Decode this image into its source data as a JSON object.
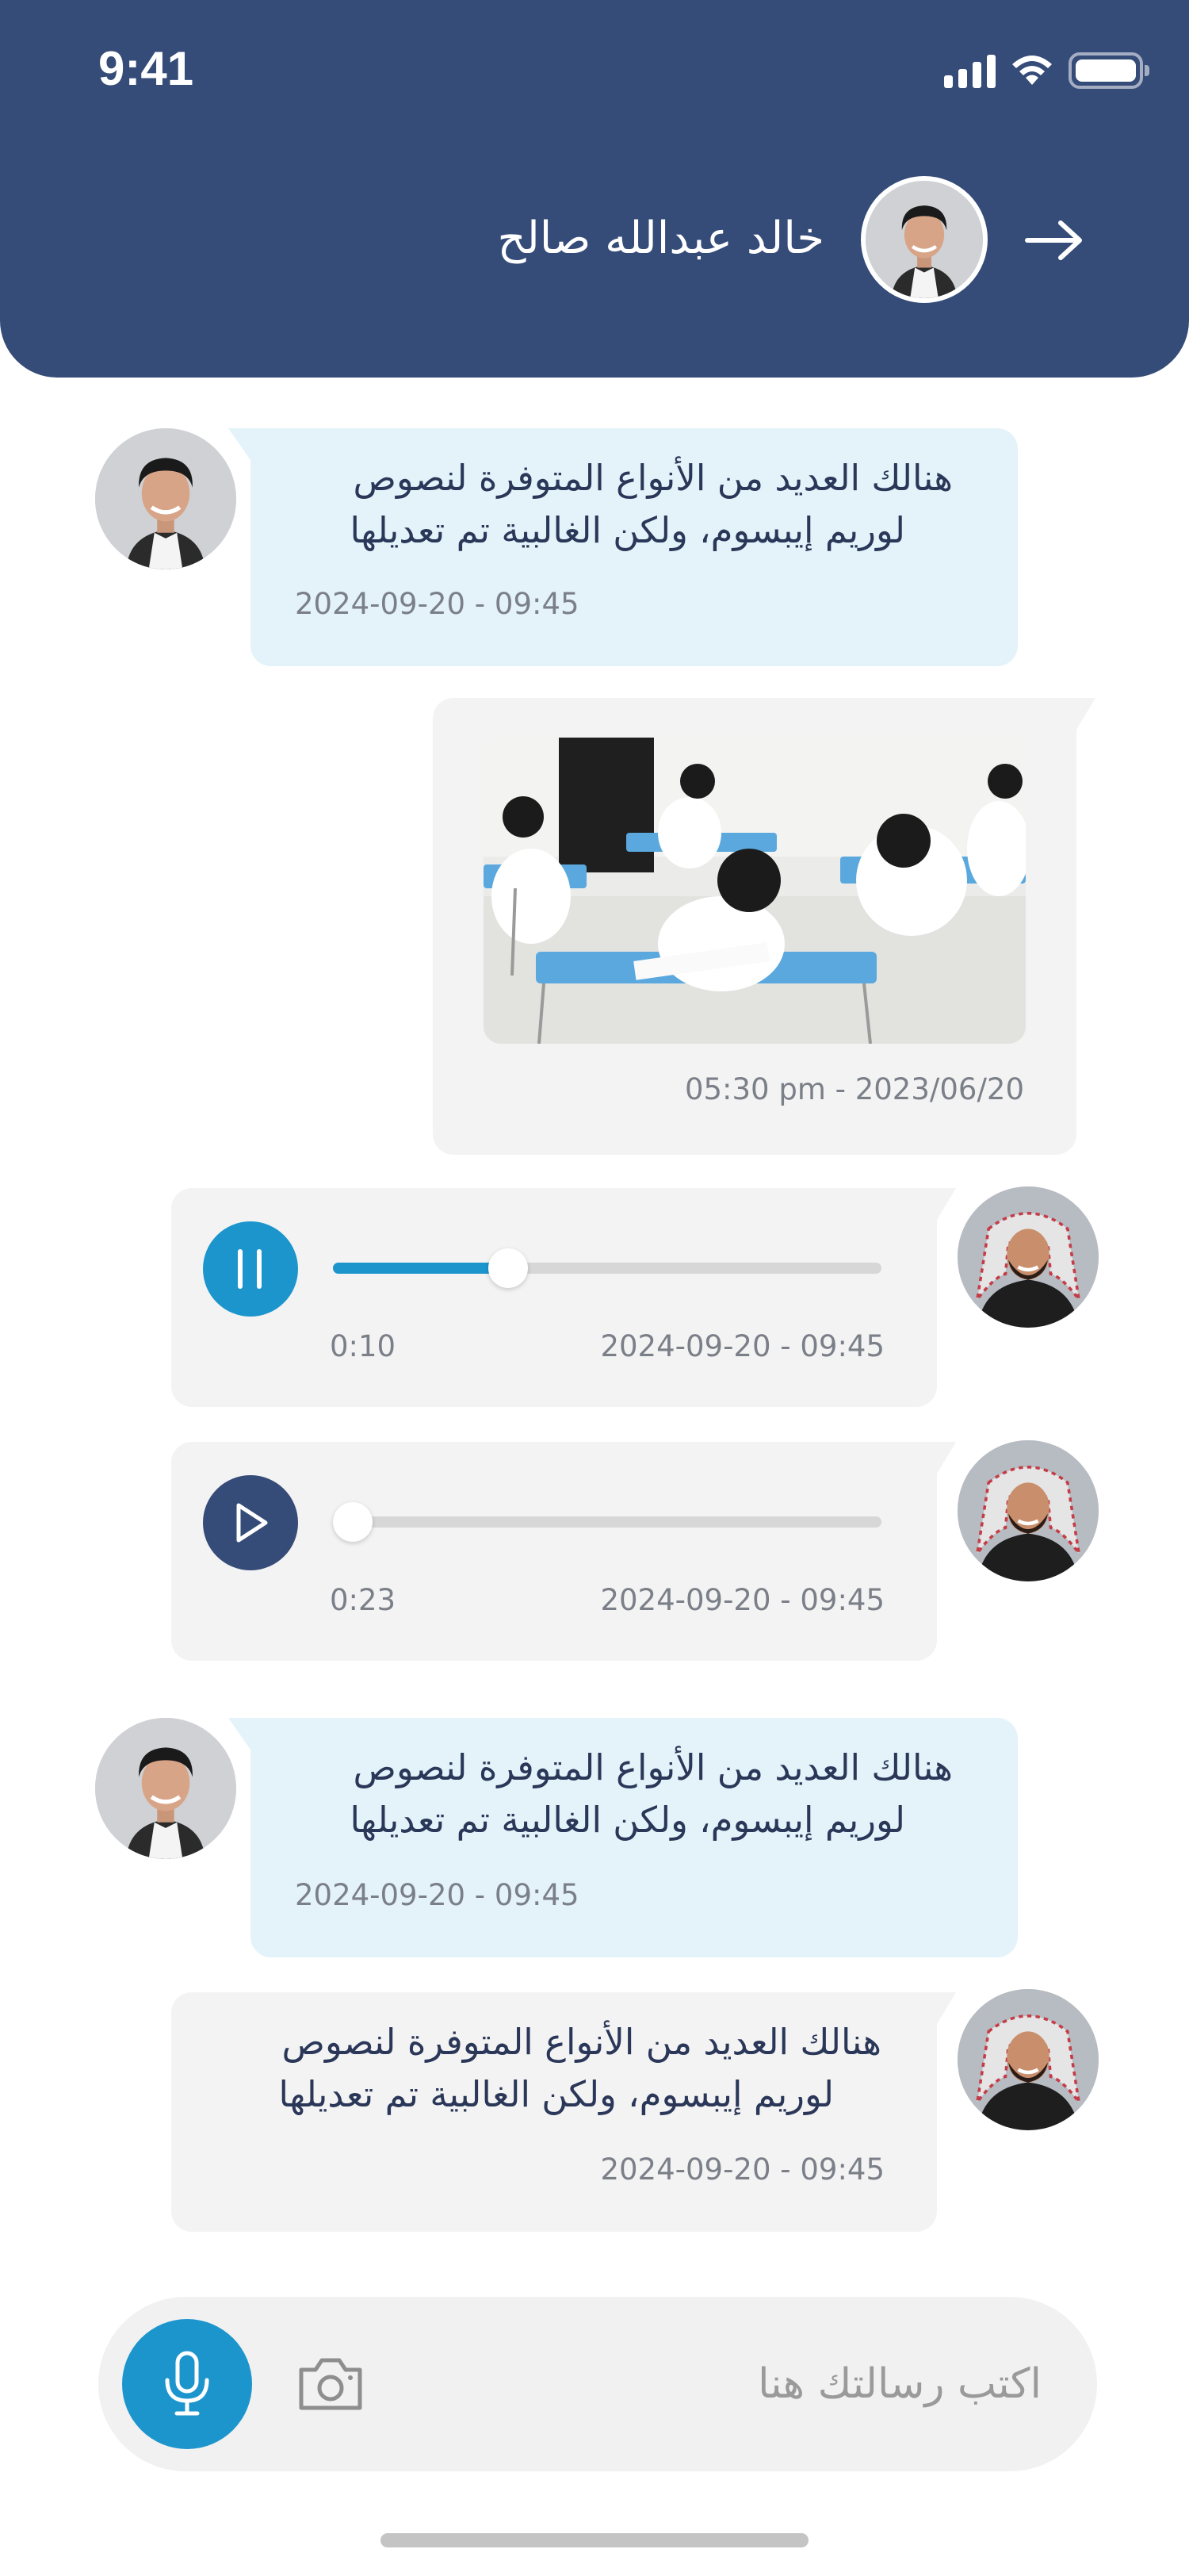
{
  "status_bar": {
    "time": "9:41"
  },
  "header": {
    "contact_name": "خالد عبدالله صالح",
    "back_icon": "arrow-right-icon",
    "avatar": "student-avatar"
  },
  "messages": [
    {
      "type": "text",
      "side": "received",
      "text_line1": "هنالك العديد من الأنواع المتوفرة لنصوص",
      "text_line2": "لوريم إيبسوم، ولكن الغالبية تم تعديلها",
      "time": "2024-09-20 - 09:45"
    },
    {
      "type": "image",
      "side": "sent",
      "image": "classroom-photo",
      "time": "05:30 pm - 2023/06/20"
    },
    {
      "type": "audio",
      "side": "sent",
      "state": "playing",
      "duration": "0:10",
      "progress": 0.32,
      "time": "2024-09-20 - 09:45"
    },
    {
      "type": "audio",
      "side": "sent",
      "state": "paused",
      "duration": "0:23",
      "progress": 0.0,
      "time": "2024-09-20 - 09:45"
    },
    {
      "type": "text",
      "side": "received",
      "text_line1": "هنالك العديد من الأنواع المتوفرة لنصوص",
      "text_line2": "لوريم إيبسوم، ولكن الغالبية تم تعديلها",
      "time": "2024-09-20 - 09:45"
    },
    {
      "type": "text",
      "side": "sent",
      "text_line1": "هنالك العديد من الأنواع المتوفرة لنصوص",
      "text_line2": "لوريم إيبسوم، ولكن الغالبية تم تعديلها",
      "time": "2024-09-20 - 09:45"
    }
  ],
  "composer": {
    "placeholder": "اكتب رسالتك هنا",
    "mic_icon": "microphone-icon",
    "camera_icon": "camera-icon"
  },
  "colors": {
    "header_bg": "#354b78",
    "accent": "#1c95cd",
    "received_bubble": "#e3f3f9",
    "sent_bubble": "#f3f3f3",
    "play_button_dark": "#354b78"
  }
}
